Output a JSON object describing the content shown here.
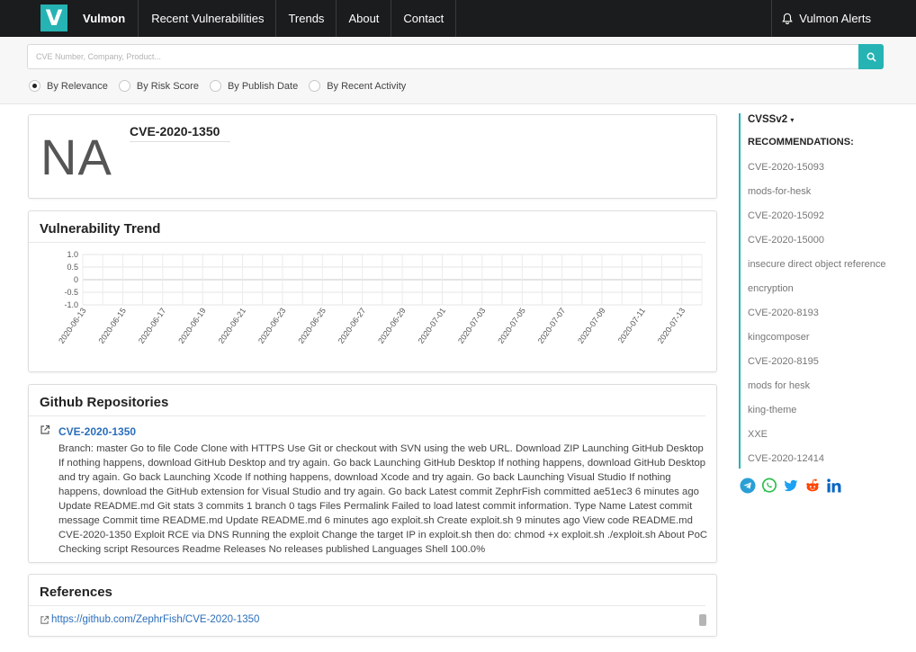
{
  "nav": {
    "logo_letter": "V",
    "brand": "Vulmon",
    "items": [
      "Recent Vulnerabilities",
      "Trends",
      "About",
      "Contact"
    ],
    "alerts_label": "Vulmon Alerts"
  },
  "search": {
    "placeholder": "CVE Number, Company, Product...",
    "sort_options": [
      {
        "label": "By Relevance",
        "selected": true
      },
      {
        "label": "By Risk Score",
        "selected": false
      },
      {
        "label": "By Publish Date",
        "selected": false
      },
      {
        "label": "By Recent Activity",
        "selected": false
      }
    ]
  },
  "vuln": {
    "score": "NA",
    "id": "CVE-2020-1350"
  },
  "trend": {
    "title": "Vulnerability Trend",
    "yticks": [
      "1.0",
      "0.5",
      "0",
      "-0.5",
      "-1.0"
    ],
    "xticks": [
      "2020-06-13",
      "2020-06-15",
      "2020-06-17",
      "2020-06-19",
      "2020-06-21",
      "2020-06-23",
      "2020-06-25",
      "2020-06-27",
      "2020-06-29",
      "2020-07-01",
      "2020-07-03",
      "2020-07-05",
      "2020-07-07",
      "2020-07-09",
      "2020-07-11",
      "2020-07-13"
    ]
  },
  "github": {
    "title": "Github Repositories",
    "repo_name": "CVE-2020-1350",
    "repo_description": "Branch: master Go to file Code Clone with HTTPS Use Git or checkout with SVN using the web URL. Download ZIP Launching GitHub Desktop If nothing happens, download GitHub Desktop and try again. Go back Launching GitHub Desktop If nothing happens, download GitHub Desktop and try again. Go back Launching Xcode If nothing happens, download Xcode and try again. Go back Launching Visual Studio If nothing happens, download the GitHub extension for Visual Studio and try again. Go back Latest commit ZephrFish committed ae51ec3 6 minutes ago Update README.md Git stats 3 commits 1 branch 0 tags Files Permalink Failed to load latest commit information. Type Name Latest commit message Commit time README.md Update README.md 6 minutes ago exploit.sh Create exploit.sh 9 minutes ago View code README.md CVE-2020-1350 Exploit RCE via DNS Running the exploit Change the target IP in exploit.sh then do: chmod +x exploit.sh ./exploit.sh About PoC Checking script Resources Readme Releases No releases published Languages Shell 100.0%"
  },
  "references": {
    "title": "References",
    "link": "https://github.com/ZephrFish/CVE-2020-1350"
  },
  "sidebar": {
    "cvss_label": "CVSSv2",
    "recommendations_heading": "RECOMMENDATIONS:",
    "recommendations": [
      "CVE-2020-15093",
      "mods-for-hesk",
      "CVE-2020-15092",
      "CVE-2020-15000",
      "insecure direct object reference",
      "encryption",
      "CVE-2020-8193",
      "kingcomposer",
      "CVE-2020-8195",
      "mods for hesk",
      "king-theme",
      "XXE",
      "CVE-2020-12414"
    ],
    "share_icons": [
      "telegram-icon",
      "whatsapp-icon",
      "twitter-icon",
      "reddit-icon",
      "linkedin-icon"
    ]
  },
  "colors": {
    "accent": "#26b3b3",
    "nav_bg": "#1b1c1d",
    "link": "#2a6ebb"
  }
}
